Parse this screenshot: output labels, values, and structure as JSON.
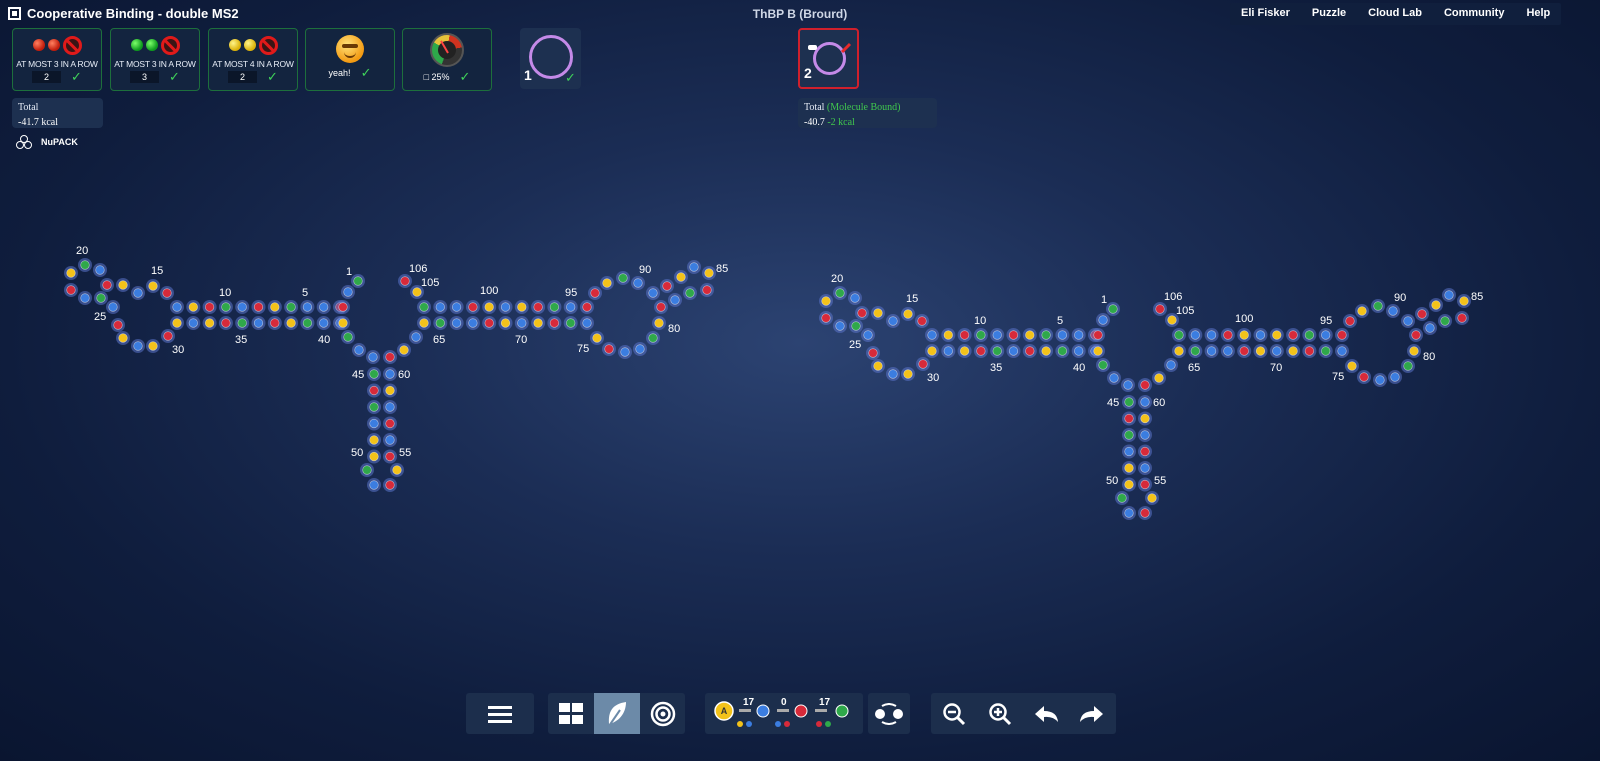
{
  "app": {
    "title": "Cooperative Binding - double MS2",
    "state_name": "ThBP B (Brourd)"
  },
  "nav": [
    "Eli Fisker",
    "Puzzle",
    "Cloud Lab",
    "Community",
    "Help"
  ],
  "constraints": [
    {
      "label": "AT MOST 3 IN A ROW",
      "value": "2",
      "balls": "red"
    },
    {
      "label": "AT MOST 3 IN A ROW",
      "value": "3",
      "balls": "green"
    },
    {
      "label": "AT MOST 4 IN A ROW",
      "value": "2",
      "balls": "yellow"
    },
    {
      "label": "yeah!"
    },
    {
      "label": "□ 25%"
    }
  ],
  "states": [
    {
      "number": "1",
      "satisfied": true
    },
    {
      "number": "2",
      "satisfied": false
    }
  ],
  "energy": {
    "left": {
      "title": "Total",
      "value": "-41.7 kcal"
    },
    "right": {
      "title": "Total",
      "note": "(Molecule Bound)",
      "value": "-40.7",
      "bonus": "-2 kcal"
    }
  },
  "engine": "NuPACK",
  "labels_left": {
    "20": "20",
    "15": "15",
    "10": "10",
    "5": "5",
    "1": "1",
    "106": "106",
    "105": "105",
    "100": "100",
    "95": "95",
    "90": "90",
    "85": "85",
    "25": "25",
    "30": "30",
    "35": "35",
    "40": "40",
    "45": "45",
    "60": "60",
    "50": "50",
    "55": "55",
    "65": "65",
    "70": "70",
    "75": "75",
    "80": "80"
  },
  "pair_counts": {
    "au": "17",
    "gu": "0",
    "gc": "17"
  },
  "colors": {
    "A": "#f3c21a",
    "U": "#3b7de0",
    "G": "#d72a3a",
    "C": "#2fa84a",
    "accent": "#c48ae8",
    "constraint_ok": "#1d6f3c",
    "constraint_fail": "#d0202c"
  },
  "toolbar": {
    "icons": [
      "menu-icon",
      "grid-icon",
      "leaf-icon",
      "target-icon",
      "swap-icon",
      "zoom-out-icon",
      "zoom-in-icon",
      "undo-icon",
      "redo-icon"
    ]
  }
}
